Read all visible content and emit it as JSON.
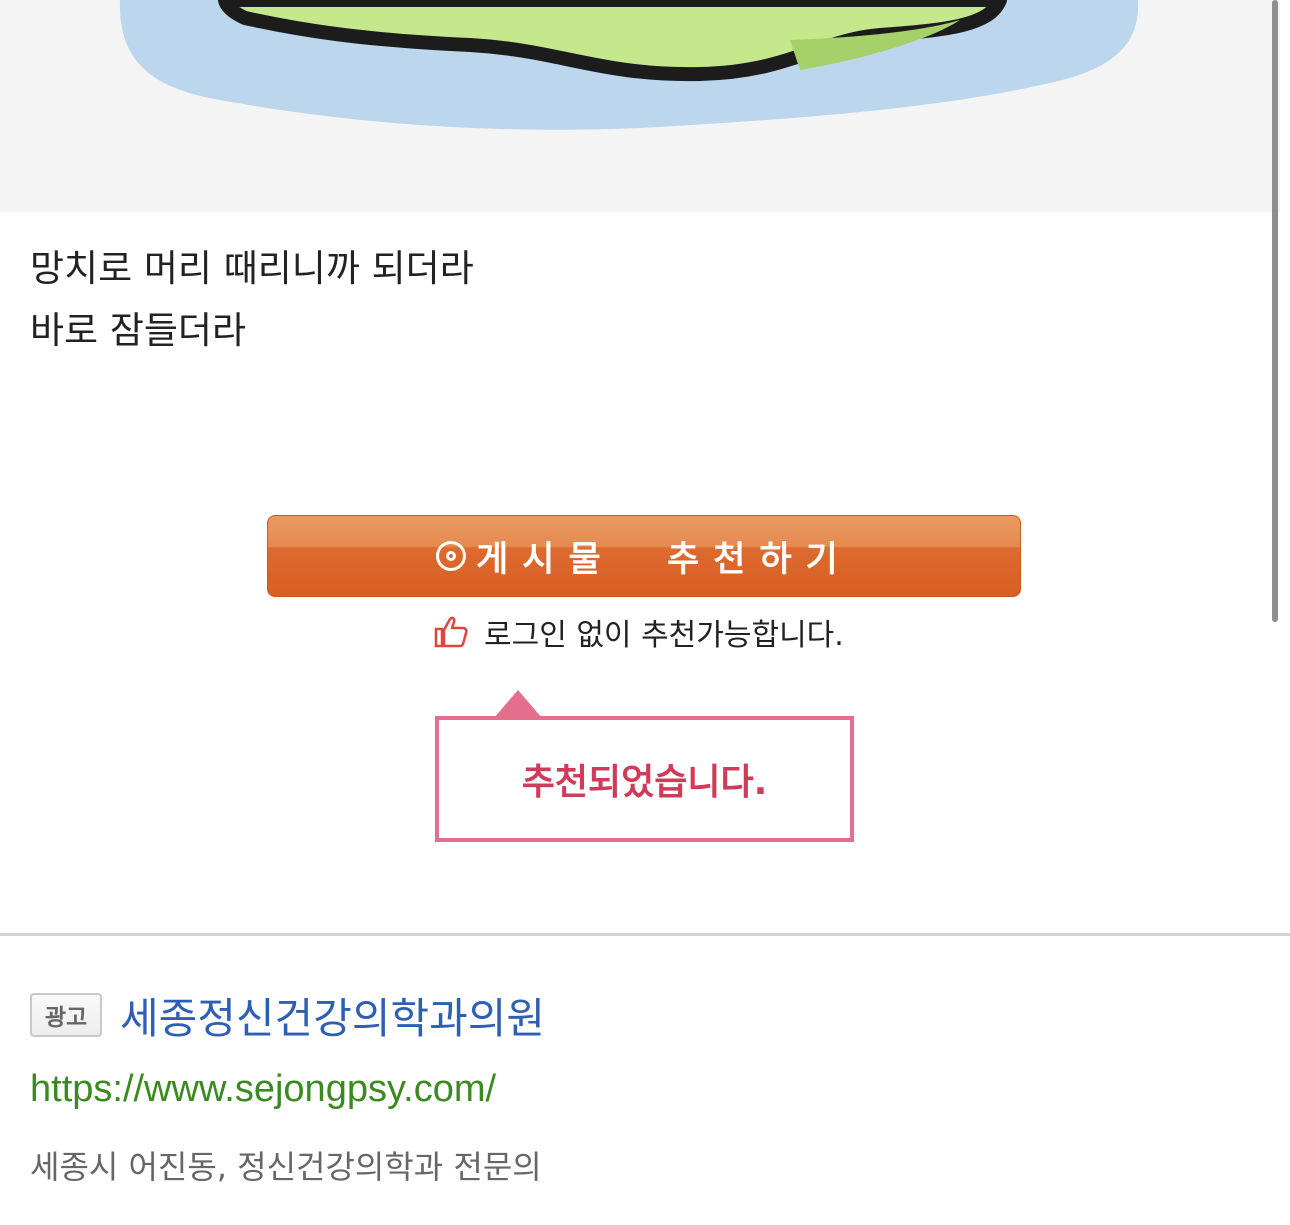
{
  "post": {
    "lines": [
      "망치로 머리 때리니까 되더라",
      "바로 잠들더라"
    ]
  },
  "recommend": {
    "button_label": "게시물  추천하기",
    "hint": "로그인 없이 추천가능합니다.",
    "popup": "추천되었습니다."
  },
  "ad": {
    "badge": "광고",
    "title": "세종정신건강의학과의원",
    "url": "https://www.sejongpsy.com/",
    "description": "세종시 어진동, 정신건강의학과 전문의"
  },
  "icons": {
    "recommend": "target-icon",
    "hint": "thumbs-up-icon"
  },
  "colors": {
    "button": "#dd6a2e",
    "popup_border": "#e56d8d",
    "popup_text": "#cf3b58",
    "ad_title": "#2f5fb3",
    "ad_url": "#3b8a1f"
  }
}
